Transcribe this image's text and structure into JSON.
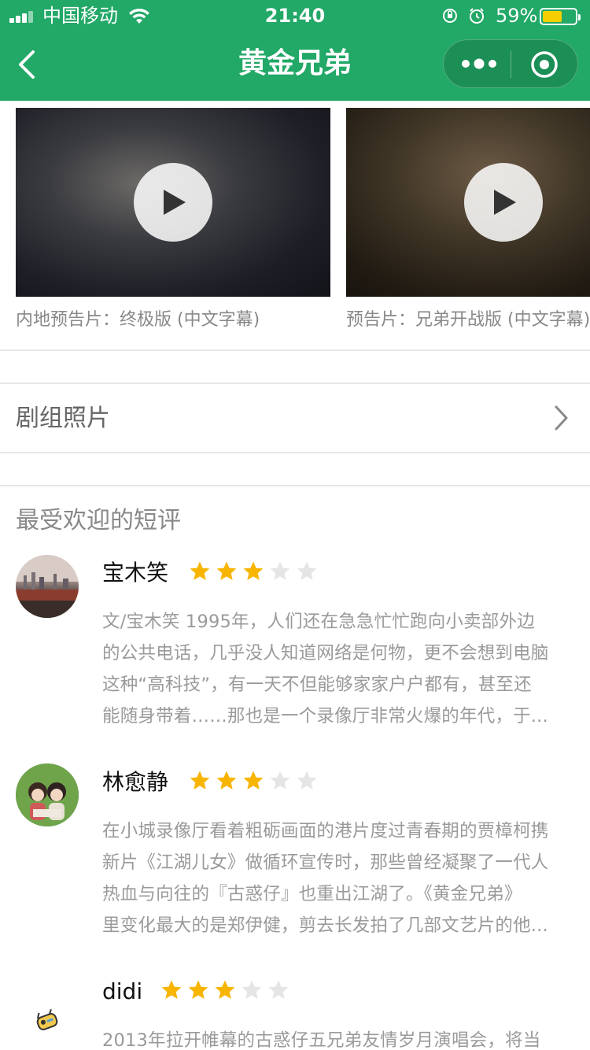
{
  "status": {
    "carrier": "中国移动",
    "time": "21:40",
    "battery": "59%"
  },
  "nav": {
    "title": "黄金兄弟"
  },
  "trailers": [
    {
      "caption": "内地预告片：终极版 (中文字幕)"
    },
    {
      "caption": "预告片：兄弟开战版 (中文字幕)"
    }
  ],
  "crew": {
    "title": "剧组照片"
  },
  "reviews_section": {
    "title": "最受欢迎的短评"
  },
  "reviews": [
    {
      "name": "宝木笑",
      "rating": 3,
      "max": 5,
      "lines": [
        "文/宝木笑 1995年，人们还在急急忙忙跑向小卖部外边",
        "的公共电话，几乎没人知道网络是何物，更不会想到电脑",
        "这种“高科技”，有一天不但能够家家户户都有，甚至还",
        "能随身带着……那也是一个录像厅非常火爆的年代，于..."
      ]
    },
    {
      "name": "林愈静",
      "rating": 3,
      "max": 5,
      "lines": [
        "在小城录像厅看着粗砺画面的港片度过青春期的贾樟柯携",
        "新片《江湖儿女》做循环宣传时，那些曾经凝聚了一代人",
        "热血与向往的『古惑仔』也重出江湖了。《黄金兄弟》",
        "里变化最大的是郑伊健，剪去长发拍了几部文艺片的他..."
      ]
    },
    {
      "name": "didi",
      "rating": 3,
      "max": 5,
      "lines": [
        "2013年拉开帷幕的古惑仔五兄弟友情岁月演唱会，将当"
      ]
    }
  ],
  "colors": {
    "brand_green": "#22a867",
    "star_on": "#f7b500",
    "star_off": "#e5e5e5",
    "battery_fill": "#f7ce00"
  }
}
